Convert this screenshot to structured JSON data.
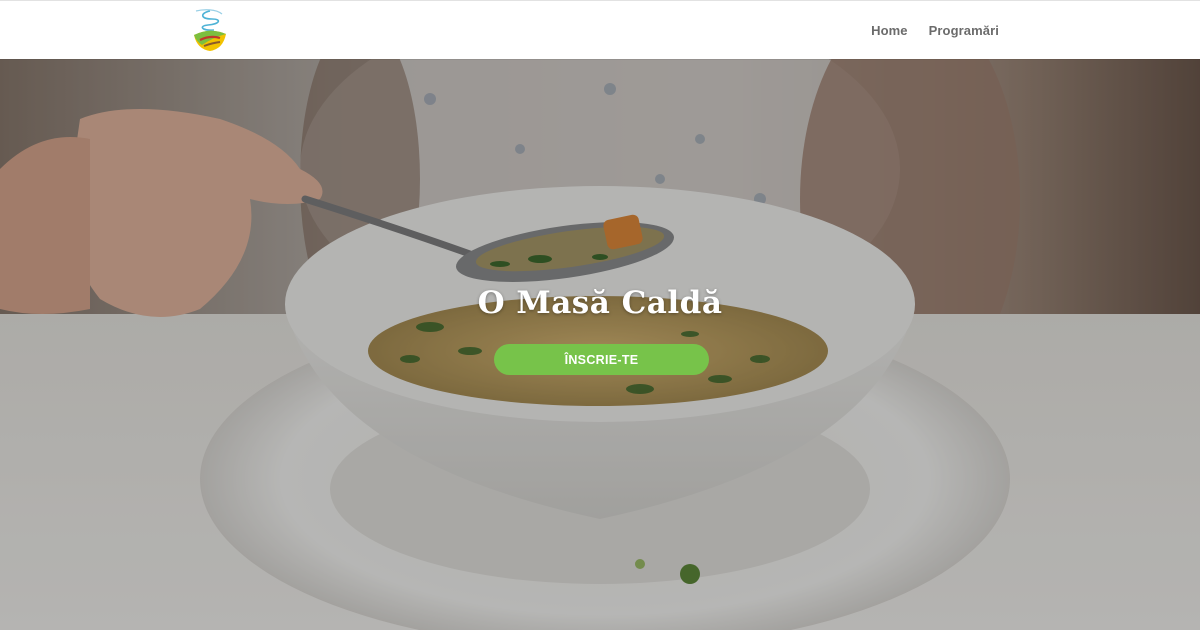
{
  "header": {
    "logo_icon": "soup-bowl-logo-icon",
    "nav": [
      {
        "label": "Home"
      },
      {
        "label": "Programări"
      }
    ]
  },
  "hero": {
    "title": "O Masă Caldă",
    "cta_label": "ÎNSCRIE-TE",
    "background_image": "bowl-of-soup-photo"
  },
  "colors": {
    "accent": "#77c34a",
    "nav_text": "#6b6b6b",
    "header_bg": "#ffffff"
  }
}
